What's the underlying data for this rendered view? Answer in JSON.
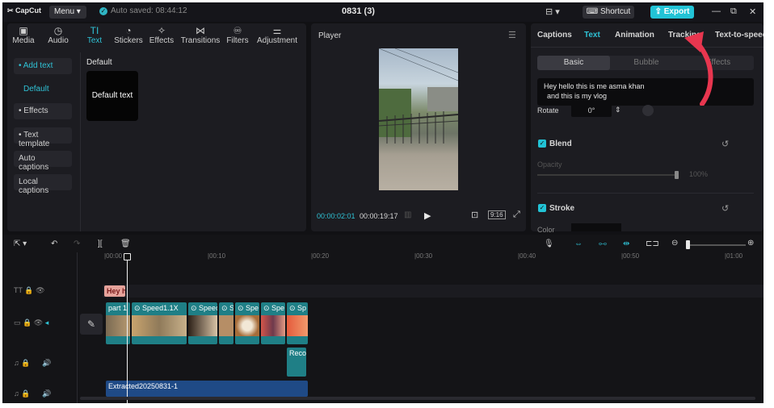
{
  "topbar": {
    "logo": "CapCut",
    "menu_label": "Menu",
    "autosave_label": "Auto saved: 08:44:12",
    "project_title": "0831 (3)",
    "shortcut_label": "Shortcut",
    "export_label": "Export"
  },
  "library_tabs": [
    {
      "label": "Media",
      "icon": "▣"
    },
    {
      "label": "Audio",
      "icon": "◷"
    },
    {
      "label": "Text",
      "icon": "TI"
    },
    {
      "label": "Stickers",
      "icon": "◔"
    },
    {
      "label": "Effects",
      "icon": "✧"
    },
    {
      "label": "Transitions",
      "icon": "⋈"
    },
    {
      "label": "Filters",
      "icon": "♾"
    },
    {
      "label": "Adjustment",
      "icon": "⚌"
    }
  ],
  "text_sidebar": {
    "add_text": "• Add text",
    "default_link": "Default",
    "effects": "• Effects",
    "text_template": "• Text template",
    "auto_captions": "Auto captions",
    "local_captions": "Local captions"
  },
  "text_library": {
    "section_title": "Default",
    "card_label": "Default text"
  },
  "player": {
    "title": "Player",
    "current_time": "00:00:02:01",
    "total_time": "00:00:19:17",
    "ratio_label": "9:16"
  },
  "props": {
    "tabs": [
      "Captions",
      "Text",
      "Animation",
      "Tracking",
      "Text-to-speech"
    ],
    "subtabs": [
      "Basic",
      "Bubble",
      "Effects"
    ],
    "text_content": [
      "Hey hello this is me asma khan",
      "and this is my vlog"
    ],
    "rotate_label": "Rotate",
    "rotate_value": "0°",
    "blend_label": "Blend",
    "opacity_label": "Opacity",
    "opacity_value": "100%",
    "stroke_label": "Stroke",
    "color_label": "Color"
  },
  "timeline": {
    "ruler": [
      "|00:00",
      "|00:10",
      "|00:20",
      "|00:30",
      "|00:40",
      "|00:50",
      "|01:00"
    ],
    "text_clip": "Hey h",
    "video_clips": [
      "part 1",
      "Speed1.1X",
      "Speed",
      "S",
      "Spe",
      "Spe",
      "Sp"
    ],
    "audio_clip": "Reco",
    "extracted_clip": "Extracted20250831-1"
  },
  "colors": {
    "accent": "#22c3d6",
    "panel": "#1c1c21",
    "background": "#111114",
    "arrow": "#e8364f",
    "video_clip": "#1f7f86",
    "extracted_clip": "#1f4a86"
  }
}
